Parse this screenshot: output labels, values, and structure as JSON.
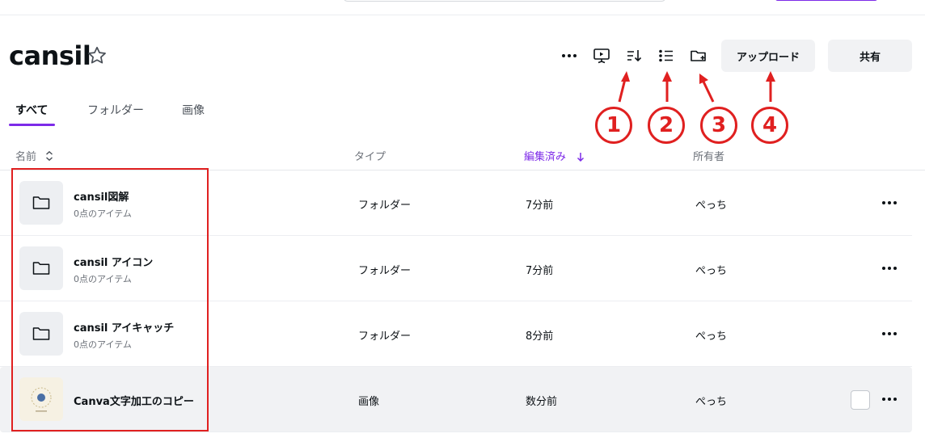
{
  "folder": {
    "title": "cansil"
  },
  "toolbar": {
    "upload_label": "アップロード",
    "share_label": "共有"
  },
  "tabs": [
    {
      "label": "すべて",
      "active": true
    },
    {
      "label": "フォルダー",
      "active": false
    },
    {
      "label": "画像",
      "active": false
    }
  ],
  "columns": {
    "name": "名前",
    "type": "タイプ",
    "edited": "編集済み",
    "owner": "所有者"
  },
  "rows": [
    {
      "name": "cansil図解",
      "sub": "0点のアイテム",
      "type": "フォルダー",
      "edited": "7分前",
      "owner": "ぺっち"
    },
    {
      "name": "cansil アイコン",
      "sub": "0点のアイテム",
      "type": "フォルダー",
      "edited": "7分前",
      "owner": "ぺっち"
    },
    {
      "name": "cansil アイキャッチ",
      "sub": "0点のアイテム",
      "type": "フォルダー",
      "edited": "8分前",
      "owner": "ぺっち"
    },
    {
      "name": "Canva文字加工のコピー",
      "type": "画像",
      "edited": "数分前",
      "owner": "ぺっち"
    }
  ],
  "annotations": [
    "1",
    "2",
    "3",
    "4"
  ],
  "colors": {
    "accent": "#7d2ae8",
    "annotation": "#e02020",
    "button_bg": "#f1f2f4"
  },
  "icons": [
    "star-icon",
    "more-horizontal-icon",
    "present-icon",
    "sort-icon",
    "list-view-icon",
    "new-folder-icon",
    "sort-toggle-icon",
    "arrow-down-icon",
    "folder-icon"
  ]
}
